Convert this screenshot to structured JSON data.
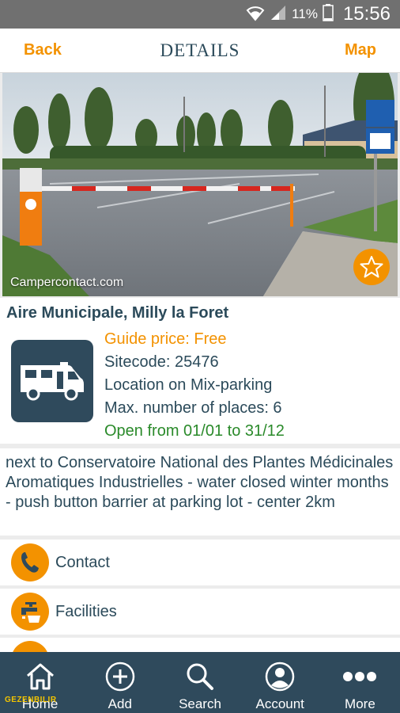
{
  "status_bar": {
    "battery": "11%",
    "time": "15:56"
  },
  "header": {
    "back": "Back",
    "title": "DETAILS",
    "map": "Map"
  },
  "photo": {
    "watermark": "Campercontact.com"
  },
  "site": {
    "name": "Aire Municipale, Milly la Foret",
    "guide_price": "Guide price: Free",
    "sitecode": "Sitecode: 25476",
    "location": "Location on Mix-parking",
    "max_places": "Max. number of places: 6",
    "open": "Open from 01/01 to 31/12"
  },
  "description": "next to Conservatoire National des Plantes Médicinales Aromatiques Industrielles - water closed winter months - push button barrier at parking lot - center 2km",
  "actions": [
    {
      "label": "Contact",
      "icon": "phone-icon"
    },
    {
      "label": "Facilities",
      "icon": "water-tap-icon"
    }
  ],
  "nav": [
    {
      "label": "Home",
      "icon": "home-icon"
    },
    {
      "label": "Add",
      "icon": "add-circle-icon"
    },
    {
      "label": "Search",
      "icon": "search-icon"
    },
    {
      "label": "Account",
      "icon": "account-icon"
    },
    {
      "label": "More",
      "icon": "more-icon"
    }
  ],
  "watermark_logo": "GEZENBILIR",
  "colors": {
    "accent": "#f39200",
    "navy": "#2f4a5c",
    "open_green": "#2a8a2a"
  }
}
